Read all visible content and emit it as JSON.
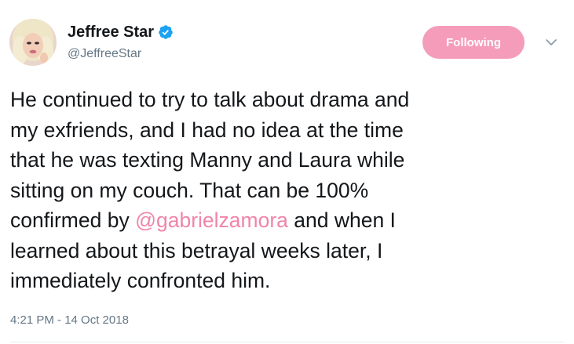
{
  "user": {
    "display_name": "Jeffree Star",
    "handle": "@JeffreeStar",
    "verified": true
  },
  "actions": {
    "follow_label": "Following"
  },
  "tweet": {
    "line1": "He continued to try to talk about drama and",
    "line2": "my exfriends, and I had no idea at the time",
    "line3": "that he was texting Manny and Laura while",
    "line4": "sitting on my couch. That can be 100%",
    "line5_before": "confirmed by ",
    "mention": "@gabrielzamora",
    "line5_after": " and when I",
    "line6": "learned about this betrayal weeks later, I",
    "line7": "immediately confronted him."
  },
  "meta": {
    "timestamp": "4:21 PM - 14 Oct 2018"
  },
  "colors": {
    "accent_pink": "#f59cbb",
    "mention_pink": "#f085a9",
    "verified_blue": "#1da1f2",
    "secondary_text": "#657786"
  },
  "icons": {
    "verified": "verified-badge-icon",
    "caret": "chevron-down-icon"
  }
}
